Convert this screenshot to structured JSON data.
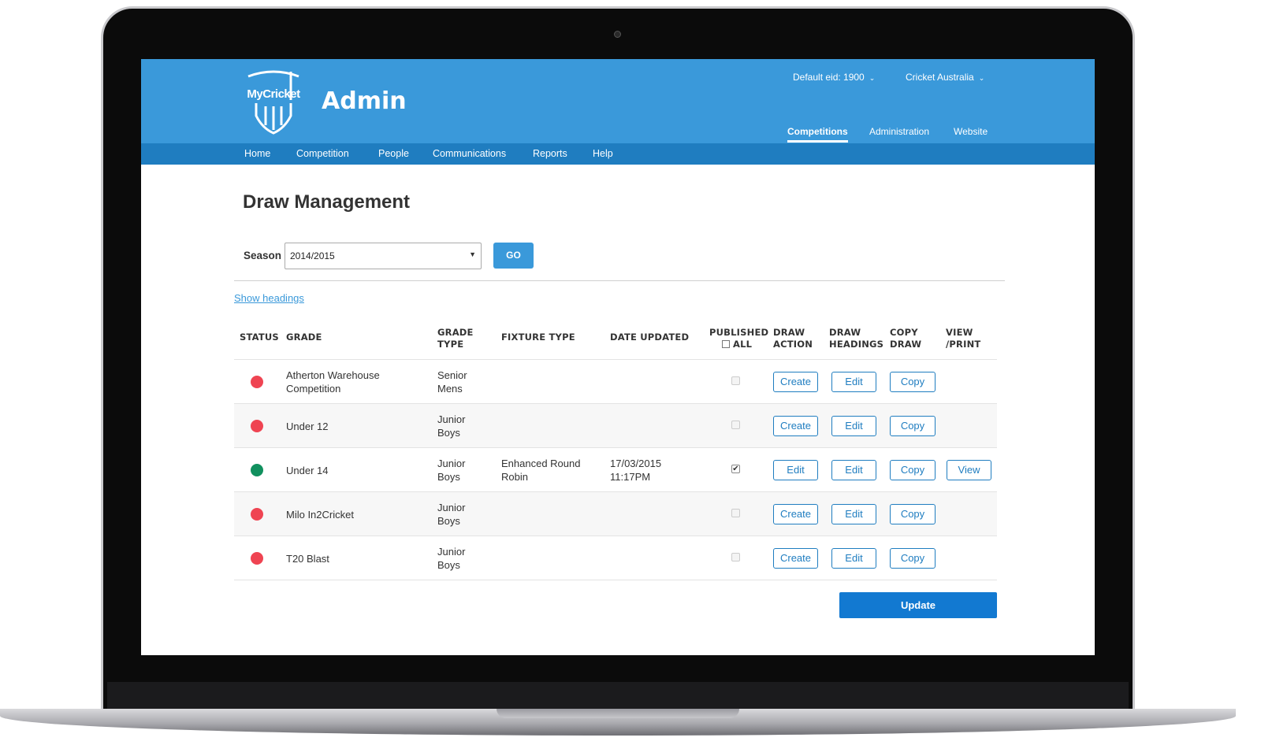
{
  "header": {
    "logo_text": "MyCricket",
    "app_title": "Admin",
    "default_eid": "Default eid: 1900",
    "organisation": "Cricket Australia",
    "tabs": [
      {
        "label": "Competitions",
        "active": true
      },
      {
        "label": "Administration",
        "active": false
      },
      {
        "label": "Website",
        "active": false
      }
    ]
  },
  "subnav": {
    "items": [
      "Home",
      "Competition",
      "People",
      "Communications",
      "Reports",
      "Help"
    ]
  },
  "page": {
    "title": "Draw Management",
    "season_label": "Season",
    "season_value": "2014/2015",
    "go_label": "GO",
    "show_headings": "Show headings",
    "update_label": "Update"
  },
  "table": {
    "headers": {
      "status": "STATUS",
      "grade": "GRADE",
      "grade_type": "GRADE\nTYPE",
      "fixture_type": "FIXTURE TYPE",
      "date_updated": "DATE UPDATED",
      "published": "PUBLISHED",
      "published_all": "ALL",
      "draw_action": "DRAW\nACTION",
      "draw_headings": "DRAW\nHEADINGS",
      "copy_draw": "COPY\nDRAW",
      "view_print": "VIEW\n/PRINT"
    },
    "rows": [
      {
        "status": "red",
        "grade": "Atherton Warehouse\nCompetition",
        "grade_type": "Senior\nMens",
        "fixture_type": "",
        "date_updated": "",
        "published": false,
        "draw_action": "Create",
        "draw_headings": "Edit",
        "copy_draw": "Copy",
        "view_print": ""
      },
      {
        "status": "red",
        "grade": "Under 12",
        "grade_type": "Junior\nBoys",
        "fixture_type": "",
        "date_updated": "",
        "published": false,
        "draw_action": "Create",
        "draw_headings": "Edit",
        "copy_draw": "Copy",
        "view_print": ""
      },
      {
        "status": "green",
        "grade": "Under 14",
        "grade_type": "Junior\nBoys",
        "fixture_type": "Enhanced Round\nRobin",
        "date_updated": "17/03/2015\n11:17PM",
        "published": true,
        "draw_action": "Edit",
        "draw_headings": "Edit",
        "copy_draw": "Copy",
        "view_print": "View"
      },
      {
        "status": "red",
        "grade": "Milo In2Cricket",
        "grade_type": "Junior\nBoys",
        "fixture_type": "",
        "date_updated": "",
        "published": false,
        "draw_action": "Create",
        "draw_headings": "Edit",
        "copy_draw": "Copy",
        "view_print": ""
      },
      {
        "status": "red",
        "grade": "T20 Blast",
        "grade_type": "Junior\nBoys",
        "fixture_type": "",
        "date_updated": "",
        "published": false,
        "draw_action": "Create",
        "draw_headings": "Edit",
        "copy_draw": "Copy",
        "view_print": ""
      }
    ]
  },
  "colors": {
    "header_blue": "#3a99da",
    "subnav_blue": "#1f7dc0",
    "status_red": "#ef4452",
    "status_green": "#11905e"
  }
}
